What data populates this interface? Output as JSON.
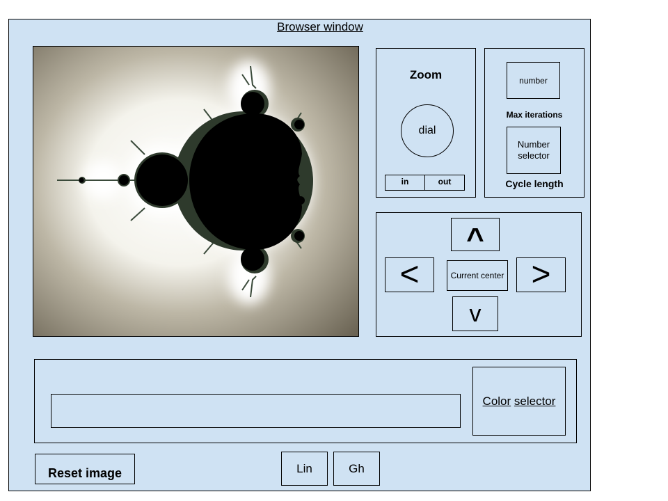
{
  "window": {
    "title": "Browser window"
  },
  "zoom": {
    "title": "Zoom",
    "dial": "dial",
    "in": "in",
    "out": "out"
  },
  "iterations": {
    "number": "number",
    "max_label": "Max iterations",
    "selector": "Number selector",
    "cycle_label": "Cycle length"
  },
  "navigation": {
    "up": "^",
    "left": "<",
    "center": "Current center",
    "right": ">",
    "down": "v"
  },
  "color": {
    "word1": "Color",
    "word2": "selector",
    "input_value": ""
  },
  "controls": {
    "reset": "Reset image",
    "lin": "Lin",
    "gh": "Gh"
  },
  "colors": {
    "panel_bg": "#cfe2f3",
    "fractal_bg": "#6b6454",
    "fractal_set": "#000000",
    "fractal_glow": "#ffffff"
  }
}
